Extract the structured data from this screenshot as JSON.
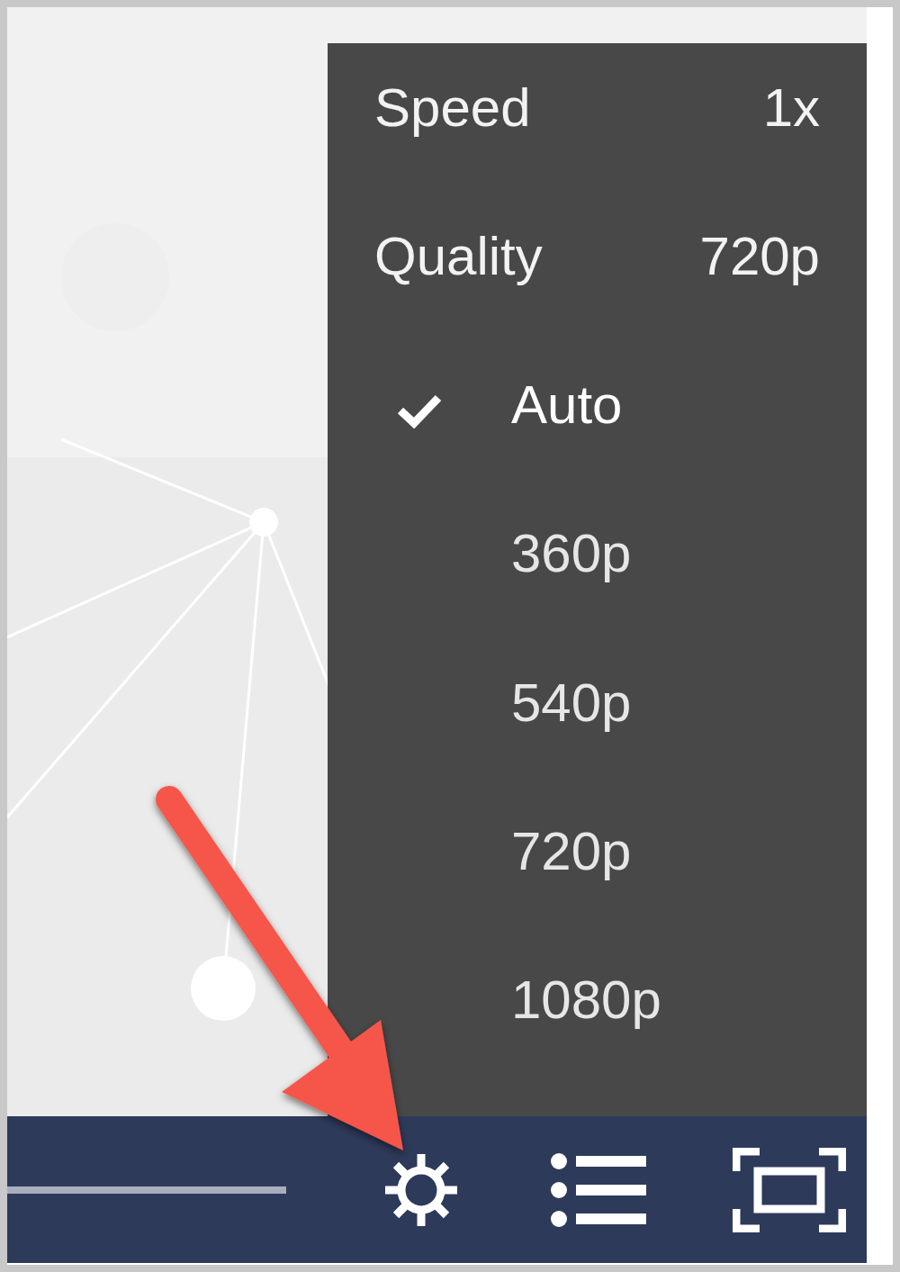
{
  "settings_menu": {
    "rows": [
      {
        "label": "Speed",
        "value": "1x"
      },
      {
        "label": "Quality",
        "value": "720p"
      }
    ],
    "options": [
      {
        "label": "Auto",
        "selected": true
      },
      {
        "label": "360p",
        "selected": false
      },
      {
        "label": "540p",
        "selected": false
      },
      {
        "label": "720p",
        "selected": false
      },
      {
        "label": "1080p",
        "selected": false
      }
    ]
  }
}
